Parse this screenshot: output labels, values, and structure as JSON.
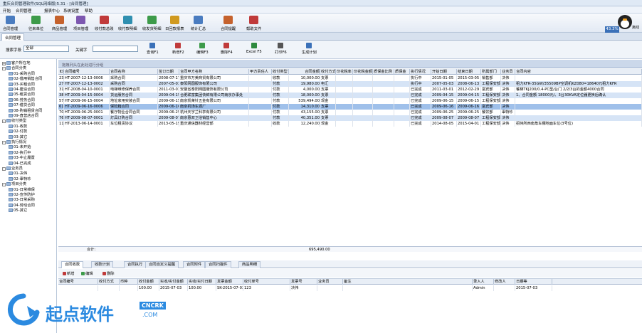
{
  "window": {
    "title": "重庆合同管理软件(SQL网络版)5.31 - [合同管理]",
    "menu": [
      "开始",
      "合同管理",
      "报表中心",
      "系统设置",
      "帮助"
    ]
  },
  "toolbar": [
    {
      "label": "合同管理",
      "color": "#4a7cc0"
    },
    {
      "label": "往来单位",
      "color": "#3d9b4a"
    },
    {
      "label": "商品管理",
      "color": "#c5622d"
    },
    {
      "label": "项目管理",
      "color": "#7d58b0"
    },
    {
      "label": "收付款总账",
      "color": "#c03a3a"
    },
    {
      "label": "收付款明细",
      "color": "#2f8fb0"
    },
    {
      "label": "收发货明细",
      "color": "#3d9b4a"
    },
    {
      "label": "日回款报表",
      "color": "#d09a20"
    },
    {
      "label": "统计汇总",
      "color": "#4a7cc0"
    },
    {
      "label": "合同提醒",
      "color": "#c5622d"
    },
    {
      "label": "帮助文件",
      "color": "#c03a3a"
    }
  ],
  "avatar": {
    "badge": "43.3%",
    "caption": "离线"
  },
  "doc_tab": "合同管理",
  "search": {
    "field_label": "搜索字段",
    "field_value": "全部",
    "keyword_label": "关键字",
    "keyword_value": "",
    "buttons": [
      {
        "label": "查询F1",
        "color": "#3a70b8"
      },
      {
        "label": "新增F2",
        "color": "#c03a3a"
      },
      {
        "label": "编辑F3",
        "color": "#3d9b4a"
      },
      {
        "label": "删除F4",
        "color": "#c03a3a"
      },
      {
        "label": "Excel F5",
        "color": "#2e8a3e"
      },
      {
        "label": "打印F6",
        "color": "#555555"
      },
      {
        "label": "生成计划",
        "color": "#3a70b8"
      }
    ]
  },
  "tree": [
    {
      "text": "客户所在地",
      "level": 0,
      "toggle": "+"
    },
    {
      "text": "合同分类",
      "level": 0,
      "toggle": "-"
    },
    {
      "text": "01-采购合同",
      "level": 1
    },
    {
      "text": "02-借用销售合同",
      "level": 1
    },
    {
      "text": "03-买租合同",
      "level": 1
    },
    {
      "text": "04-建设合同",
      "level": 1
    },
    {
      "text": "05-租赁合同",
      "level": 1
    },
    {
      "text": "06-劳务合同",
      "level": 1
    },
    {
      "text": "07-借贷合同",
      "level": 1
    },
    {
      "text": "08-购销租赁合同",
      "level": 1
    },
    {
      "text": "09-直营店合同",
      "level": 1
    },
    {
      "text": "收付类型",
      "level": 0,
      "toggle": "-"
    },
    {
      "text": "01-收款",
      "level": 1
    },
    {
      "text": "02-付款",
      "level": 1
    },
    {
      "text": "03-其它",
      "level": 1
    },
    {
      "text": "执行情况",
      "level": 0,
      "toggle": "-"
    },
    {
      "text": "01-未开始",
      "level": 1
    },
    {
      "text": "02-执行中",
      "level": 1
    },
    {
      "text": "03-中止履置",
      "level": 1
    },
    {
      "text": "04-已完成",
      "level": 1
    },
    {
      "text": "业务员",
      "level": 0,
      "toggle": "-"
    },
    {
      "text": "01-决伟",
      "level": 1
    },
    {
      "text": "02-辜特珍",
      "level": 1
    },
    {
      "text": "项目分类",
      "level": 0,
      "toggle": "-"
    },
    {
      "text": "01-日常维保",
      "level": 1
    },
    {
      "text": "02-宣传防护",
      "level": 1
    },
    {
      "text": "03-日常采购",
      "level": 1
    },
    {
      "text": "04-劳动合同",
      "level": 1
    },
    {
      "text": "05-其它",
      "level": 1
    }
  ],
  "grid": {
    "group_hint": "拖拽列头在此处进行分组",
    "columns": [
      "ID",
      "合同编号",
      "合同名称",
      "签订日期",
      "合同甲方名称",
      "甲方责任人",
      "收付类型",
      "合同金额",
      "收付方式",
      "印花税率",
      "印花税金额",
      "质保金比例",
      "质保金",
      "执行情况",
      "开始日期",
      "结束日期",
      "所属部门",
      "业务员",
      "合同内容"
    ],
    "rows": [
      [
        "23",
        "HT-2007-12-13-0006",
        "采购合同",
        "2008-07-17",
        "重庆市万美商贸有限公司",
        "",
        "收款",
        "10,000.00",
        "支票",
        "",
        "",
        "",
        "",
        "执行中",
        "2015-01-05",
        "2015-03-05",
        "销售部",
        "决伟",
        ""
      ],
      [
        "27",
        "HT-2007-12-13-0002",
        "采购合同",
        "2007-05-03",
        "泰阳网圆服饰有限公司",
        "",
        "付款",
        "19,980.00",
        "电汇",
        "",
        "",
        "",
        "",
        "执行中",
        "2007-05-03",
        "2008-06-13",
        "工程保安部",
        "决伟",
        "租力KFR-35GW/35509BP空调机KZ080=18640元租力KFR"
      ],
      [
        "31",
        "HT-2008-04-10-0001",
        "电梯维修保养合同",
        "2011-03-01",
        "安徽省泰阳网圆服饰有限公司",
        "",
        "付款",
        "4,000.00",
        "支票",
        "",
        "",
        "",
        "",
        "已完成",
        "2011-03-01",
        "2012-02-29",
        "富宾部",
        "决伟",
        "餐梯TKJ200/0.4-PC型/台门 2/2/3台的金额4000合同"
      ],
      [
        "38",
        "HT-2009-04-15-0004",
        "货运服务合同",
        "2009-04-15",
        "合肥联富集团快鲜有限公司南京办事处",
        "",
        "付款",
        "18,000.00",
        "支票",
        "",
        "",
        "",
        "",
        "已完成",
        "2009-04-15",
        "2009-04-15",
        "工程保安部",
        "决伟",
        "1、合同金额 18000元/、3台30KVA定位器更换后确认"
      ],
      [
        "57",
        "HT-2009-06-15-0004",
        "地址家用实装合同",
        "2009-06-15",
        "南京凯莱针五金有限公司",
        "",
        "付款",
        "539,494.00",
        "现金",
        "",
        "",
        "",
        "",
        "已完成",
        "2009-06-15",
        "2009-06-15",
        "工程保安部",
        "决伟",
        ""
      ],
      [
        "61",
        "HT-2009-06-16-0006",
        "保险箱合同",
        "2009-06-16",
        "南京机场车源厂",
        "",
        "付款",
        "14,310.00",
        "支票",
        "",
        "",
        "",
        "",
        "已完成",
        "2009-06-16",
        "2009-06-16",
        "富宾部",
        "决伟",
        ""
      ],
      [
        "70",
        "HT-2009-06-25-0001",
        "餐厅物业合同合同",
        "2009-06-25",
        "杭州天宇兰科亭有限公司",
        "",
        "付款",
        "43,155.00",
        "支票",
        "",
        "",
        "",
        "",
        "已完成",
        "2009-06-25",
        "2009-06-25",
        "餐饮部",
        "辜特珍",
        ""
      ],
      [
        "76",
        "HT-2009-08-07-0001",
        "灯具订购合同",
        "2009-08-07",
        "南京惠双卫浴销售中心",
        "",
        "付款",
        "40,351.00",
        "支票",
        "",
        "",
        "",
        "",
        "已完成",
        "2009-08-07",
        "2009-08-07",
        "工程保安部",
        "决伟",
        ""
      ],
      [
        "117",
        "HT-2013-06-14-0001",
        "车位租赁协议",
        "2013-05-19",
        "重庆通信器材经营部",
        "",
        "收款",
        "12,240.00",
        "现金",
        "",
        "",
        "",
        "",
        "已完成",
        "2014-08-05",
        "2015-04-01",
        "工程保安部",
        "决伟",
        "招待所西南角车棚地面车位(3号位)"
      ]
    ],
    "summary_label": "合计:",
    "summary_value": "695,490.00"
  },
  "subtabs": [
    "合同收款",
    "收款计划",
    "合同执行",
    "合同自定义提醒",
    "合同附件",
    "合同扫描件",
    "商品明细"
  ],
  "sub_toolbar": [
    {
      "label": "新增",
      "color": "#c03a3a"
    },
    {
      "label": "编辑",
      "color": "#3d9b4a"
    },
    {
      "label": "删除",
      "color": "#c03a3a"
    }
  ],
  "subgrid": {
    "columns": [
      "合同编号",
      "收付方式",
      "币种",
      "收付金额",
      "实收/实付金额",
      "实收/实付日期",
      "发票金额",
      "收付单号",
      "发票号",
      "业务员",
      "备注",
      "录入人",
      "修改人",
      "日期等"
    ],
    "rows": [
      [
        "",
        "",
        "",
        "100.00",
        "2015-07-03",
        "100.00",
        "SK-2015-07-03-0001",
        "123",
        "决伟",
        "",
        "",
        "Admin",
        "",
        "2015-07-03"
      ]
    ]
  },
  "watermark": {
    "brand": "起点软件",
    "tag1": "CNCRK",
    "tag2": ".COM"
  }
}
